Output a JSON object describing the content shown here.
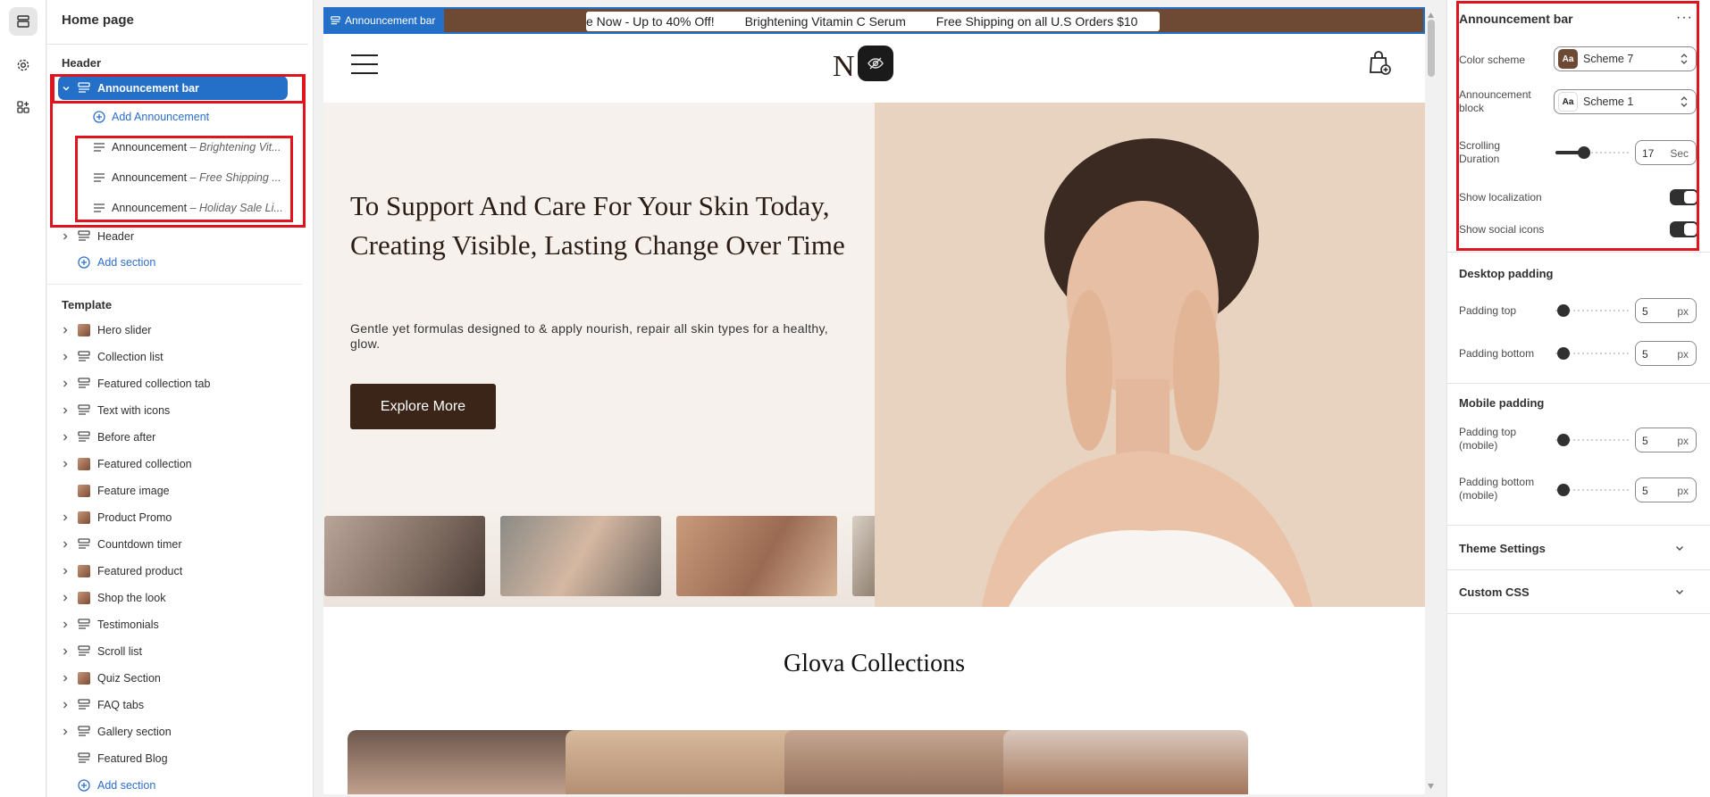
{
  "left_panel": {
    "title": "Home page",
    "header_group": "Header",
    "selected_section": "Announcement bar",
    "add_announcement": "Add Announcement",
    "announcements": [
      {
        "label": "Announcement",
        "detail": "– Brightening Vit..."
      },
      {
        "label": "Announcement",
        "detail": "– Free Shipping ..."
      },
      {
        "label": "Announcement",
        "detail": "– Holiday Sale Li..."
      }
    ],
    "header_section": "Header",
    "add_section": "Add section",
    "template_group": "Template",
    "template_sections": [
      "Hero slider",
      "Collection list",
      "Featured collection tab",
      "Text with icons",
      "Before after",
      "Featured collection",
      "Feature image",
      "Product Promo",
      "Countdown timer",
      "Featured product",
      "Shop the look",
      "Testimonials",
      "Scroll list",
      "Quiz Section",
      "FAQ tabs",
      "Gallery section",
      "Featured Blog"
    ],
    "add_section_2": "Add section"
  },
  "preview": {
    "announcement_tag": "Announcement bar",
    "ticker": [
      "e Now - Up to 40% Off!",
      "Brightening Vitamin C Serum",
      "Free Shipping on all U.S Orders $10"
    ],
    "logo": "N  S",
    "hero": {
      "heading": "To Support And Care For Your Skin Today, Creating Visible, Lasting Change Over Time",
      "paragraph": "Gentle yet formulas designed to & apply nourish, repair all skin types for a healthy, glow.",
      "button": "Explore More"
    },
    "collections_title": "Glova Collections"
  },
  "settings": {
    "title": "Announcement bar",
    "more": "···",
    "color_scheme_label": "Color scheme",
    "color_scheme_value": "Scheme 7",
    "announcement_block_label": "Announcement block",
    "announcement_block_value": "Scheme 1",
    "scrolling_duration_label": "Scrolling Duration",
    "scrolling_duration_value": "17",
    "scrolling_duration_unit": "Sec",
    "scrolling_duration_fraction": 0.3,
    "show_localization_label": "Show localization",
    "show_localization": true,
    "show_social_label": "Show social icons",
    "show_social": true,
    "desktop_padding": {
      "title": "Desktop padding",
      "top_label": "Padding top",
      "top_value": "5",
      "top_unit": "px",
      "bottom_label": "Padding bottom",
      "bottom_value": "5",
      "bottom_unit": "px"
    },
    "mobile_padding": {
      "title": "Mobile padding",
      "top_label": "Padding top (mobile)",
      "top_value": "5",
      "top_unit": "px",
      "bottom_label": "Padding bottom (mobile)",
      "bottom_value": "5",
      "bottom_unit": "px"
    },
    "theme_settings": "Theme Settings",
    "custom_css": "Custom CSS",
    "swatch_aa": "Aa",
    "colors": {
      "accent": "#2470c9",
      "highlight": "#e0141e",
      "announcement_bg": "#6e4a35",
      "swatch7": "#6e4a35"
    }
  }
}
